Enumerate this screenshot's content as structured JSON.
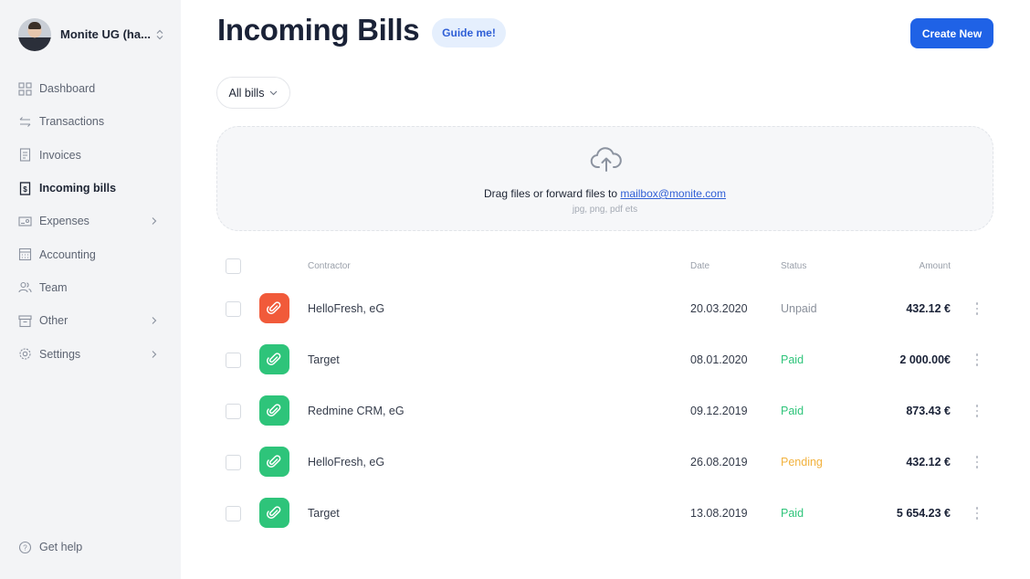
{
  "account": {
    "name": "Monite UG (ha..."
  },
  "nav": [
    {
      "label": "Dashboard",
      "icon": "dashboard-icon",
      "active": false,
      "has_submenu": false
    },
    {
      "label": "Transactions",
      "icon": "transactions-icon",
      "active": false,
      "has_submenu": false
    },
    {
      "label": "Invoices",
      "icon": "invoices-icon",
      "active": false,
      "has_submenu": false
    },
    {
      "label": "Incoming bills",
      "icon": "incoming-bills-icon",
      "active": true,
      "has_submenu": false
    },
    {
      "label": "Expenses",
      "icon": "expenses-icon",
      "active": false,
      "has_submenu": true
    },
    {
      "label": "Accounting",
      "icon": "accounting-icon",
      "active": false,
      "has_submenu": false
    },
    {
      "label": "Team",
      "icon": "team-icon",
      "active": false,
      "has_submenu": false
    },
    {
      "label": "Other",
      "icon": "archive-icon",
      "active": false,
      "has_submenu": true
    },
    {
      "label": "Settings",
      "icon": "gear-icon",
      "active": false,
      "has_submenu": true
    }
  ],
  "help": {
    "label": "Get help"
  },
  "header": {
    "title": "Incoming Bills",
    "guide_label": "Guide me!",
    "create_label": "Create New"
  },
  "filter": {
    "label": "All bills"
  },
  "dropzone": {
    "text": "Drag files or forward files to ",
    "email": "mailbox@monite.com",
    "hint": "jpg, png, pdf ets"
  },
  "table": {
    "headers": {
      "contractor": "Contractor",
      "date": "Date",
      "status": "Status",
      "amount": "Amount"
    },
    "rows": [
      {
        "contractor": "HelloFresh, eG",
        "date": "20.03.2020",
        "status": "Unpaid",
        "amount": "432.12 €"
      },
      {
        "contractor": "Target",
        "date": "08.01.2020",
        "status": "Paid",
        "amount": "2 000.00€"
      },
      {
        "contractor": "Redmine CRM, eG",
        "date": "09.12.2019",
        "status": "Paid",
        "amount": "873.43 €"
      },
      {
        "contractor": "HelloFresh, eG",
        "date": "26.08.2019",
        "status": "Pending",
        "amount": "432.12 €"
      },
      {
        "contractor": "Target",
        "date": "13.08.2019",
        "status": "Paid",
        "amount": "5 654.23 €"
      }
    ]
  },
  "colors": {
    "accent": "#1f62e6",
    "unpaid_icon": "#f15a3a",
    "paid_icon": "#2ec47a",
    "status_unpaid": "#8a909b",
    "status_paid": "#2ec47a",
    "status_pending": "#f2b23e"
  }
}
